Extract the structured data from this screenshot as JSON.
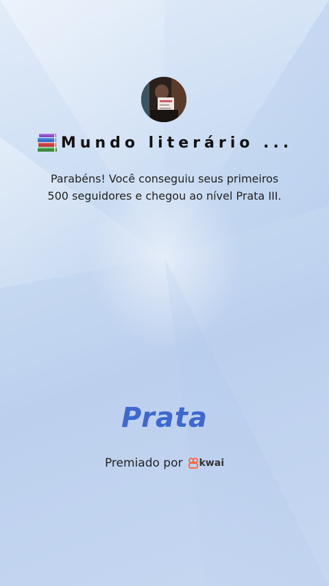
{
  "profile": {
    "name": "Mundo literário ...",
    "avatar_icon": "profile-photo"
  },
  "message": {
    "line1": "Parabéns! Você conseguiu seus primeiros",
    "line2": "500 seguidores e chegou ao nível Prata III."
  },
  "level": {
    "name": "Prata",
    "color": "#3e67cf"
  },
  "awarded": {
    "label": "Premiado por",
    "brand": "kwai",
    "brand_color": "#ff6a3d"
  },
  "background": {
    "top_color": "#e2ecf9",
    "bottom_color": "#c6d7f0"
  }
}
